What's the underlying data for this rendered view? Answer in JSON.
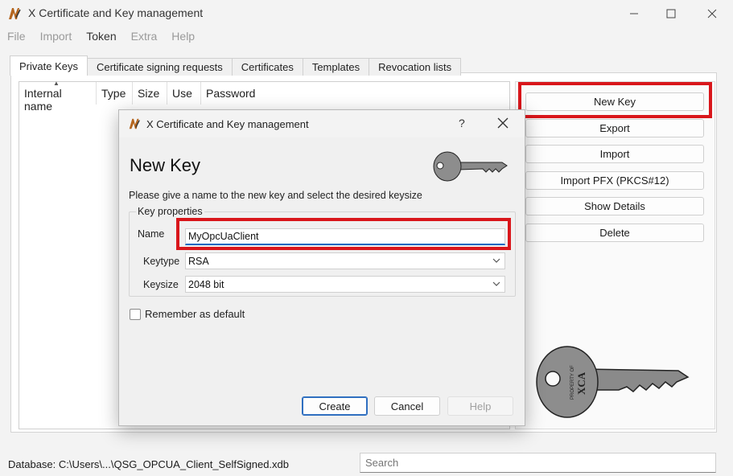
{
  "window": {
    "title": "X Certificate and Key management"
  },
  "menu": [
    "File",
    "Import",
    "Token",
    "Extra",
    "Help"
  ],
  "tabs": [
    "Private Keys",
    "Certificate signing requests",
    "Certificates",
    "Templates",
    "Revocation lists"
  ],
  "key_list": {
    "columns": [
      "Internal name",
      "Type",
      "Size",
      "Use",
      "Password"
    ]
  },
  "side_buttons": {
    "new_key": "New Key",
    "export": "Export",
    "import": "Import",
    "import_pfx": "Import PFX (PKCS#12)",
    "show_details": "Show Details",
    "delete": "Delete"
  },
  "key_logo_text": {
    "line1": "PROPERTY OF",
    "line2": "XCA"
  },
  "status": {
    "database": "Database: C:\\Users\\...\\QSG_OPCUA_Client_SelfSigned.xdb",
    "search_placeholder": "Search"
  },
  "dialog": {
    "title": "X Certificate and Key management",
    "help_symbol": "?",
    "heading": "New Key",
    "description": "Please give a name to the new key and select the desired keysize",
    "group_title": "Key properties",
    "name_label": "Name",
    "name_value": "MyOpcUaClient",
    "keytype_label": "Keytype",
    "keytype_value": "RSA",
    "keysize_label": "Keysize",
    "keysize_value": "2048 bit",
    "remember_label": "Remember as default",
    "create": "Create",
    "cancel": "Cancel",
    "help": "Help"
  },
  "colors": {
    "highlight": "#d9161b",
    "focus_blue": "#0067c0"
  }
}
